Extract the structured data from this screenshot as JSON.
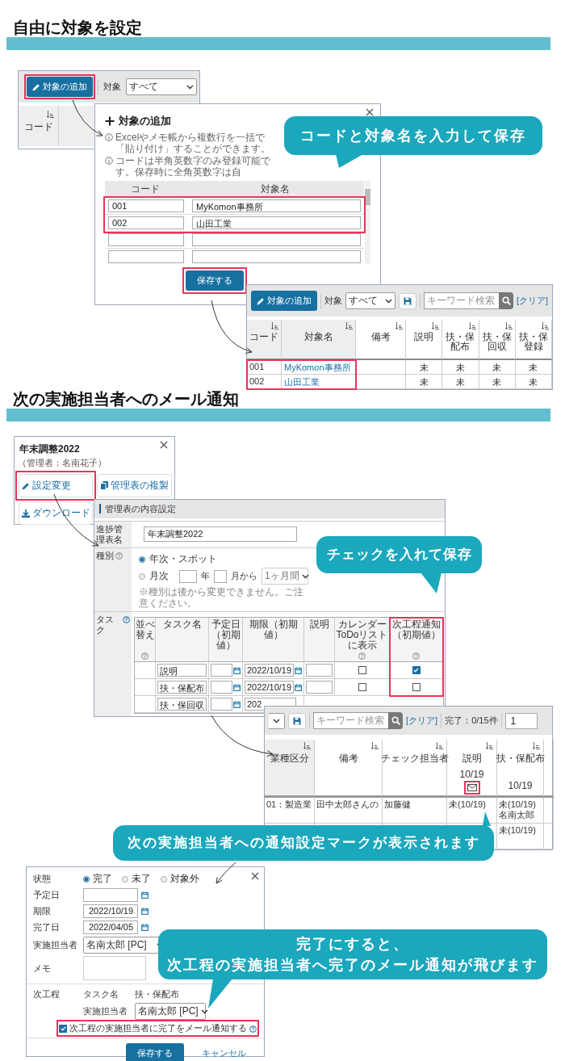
{
  "section_1": {
    "heading": "自由に対象を設定",
    "list_panel": {
      "add_button": {
        "label": "対象の追加",
        "highlighted": true
      },
      "filter_label": "対象",
      "filter_value": "すべて",
      "columns": [
        "コード"
      ]
    },
    "add_dialog": {
      "title": "対象の追加",
      "notes": [
        "Excelやメモ帳から複数行を一括で「貼り付け」することができます。",
        "コードは半角英数字のみ登録可能です。保存時に全角英数字は自"
      ],
      "columns": [
        "コード",
        "対象名"
      ],
      "rows": [
        {
          "kind": "filled",
          "code": "001",
          "name": "MyKomon事務所"
        },
        {
          "kind": "filled",
          "code": "002",
          "name": "山田工業"
        },
        {
          "kind": "blank"
        },
        {
          "kind": "blank"
        }
      ],
      "rows_highlighted": true,
      "save_button": {
        "label": "保存する",
        "highlighted": true
      }
    },
    "callout": [
      "コードと対象名を入力して保存"
    ],
    "result_panel": {
      "add_button": "対象の追加",
      "filter_label": "対象",
      "filter_value": "すべて",
      "search_placeholder": "キーワード検索",
      "clear_link": "[クリア]",
      "columns": [
        "コード",
        "対象名",
        "備考",
        "説明",
        "扶・保配布",
        "扶・保回収",
        "扶・保登録"
      ],
      "rows": [
        {
          "code": "001",
          "name": "MyKomon事務所",
          "statuses": [
            "未",
            "未",
            "未",
            "未"
          ]
        },
        {
          "code": "002",
          "name": "山田工業",
          "statuses": [
            "未",
            "未",
            "未",
            "未"
          ]
        }
      ],
      "rows_highlighted": true
    }
  },
  "section_2": {
    "heading": "次の実施担当者へのメール通知",
    "task_card": {
      "title": "年末調整2022",
      "manager": "（管理者：名南花子）",
      "buttons": [
        {
          "label": "設定変更",
          "highlighted": true
        },
        {
          "label": "管理表の複製",
          "highlighted": false
        },
        {
          "label": "ダウンロード",
          "highlighted": false
        }
      ]
    },
    "settings_panel": {
      "title": "管理表の内容設定",
      "name_label": "進捗管理表名",
      "name_value": "年末調整2022",
      "type_label": "種別",
      "type_options": [
        {
          "label": "年次・スポット",
          "selected": true
        },
        {
          "label": "月次",
          "selected": false
        }
      ],
      "year_unit": "年",
      "month_from": "月から",
      "period_value": "1ヶ月間",
      "type_note": "※種別は後から変更できません。ご注意ください。",
      "task_label": "タスク",
      "task_columns": [
        {
          "label": "並べ替え",
          "help": true
        },
        {
          "label": "タスク名",
          "help": false
        },
        {
          "label": "予定日（初期値）",
          "help": false
        },
        {
          "label": "期限（初期値）",
          "help": false
        },
        {
          "label": "説明",
          "help": false
        },
        {
          "label": "カレンダーToDoリストに表示",
          "help": true
        },
        {
          "label": "次工程通知（初期値）",
          "help": true
        }
      ],
      "tasks": [
        {
          "name": "説明",
          "due": "2022/10/19",
          "calendar": false,
          "notify": true
        },
        {
          "name": "扶・保配布",
          "due": "2022/10/19",
          "calendar": false,
          "notify": false
        },
        {
          "name": "扶・保回収",
          "due": "202"
        }
      ],
      "notify_column_highlighted": true
    },
    "callout_1": [
      "チェックを入れて保存"
    ],
    "status_panel": {
      "search_placeholder": "キーワード検索",
      "clear_link": "[クリア]",
      "progress": "完了：0/15件",
      "page": "1",
      "columns": [
        {
          "label": "業種区分",
          "mail_mark": false,
          "highlighted": false
        },
        {
          "label": "備考",
          "mail_mark": false,
          "highlighted": false
        },
        {
          "label": "チェック担当者",
          "mail_mark": false,
          "highlighted": false
        },
        {
          "label": "説明",
          "date": "10/19",
          "mail_mark": true,
          "highlighted": true
        },
        {
          "label": "扶・保配布",
          "date": "10/19",
          "mail_mark": false,
          "highlighted": false
        }
      ],
      "rows": [
        {
          "cells": [
            [
              "01：製造業"
            ],
            [
              "田中太郎さんの"
            ],
            [
              "加藤健"
            ],
            [
              "未(10/19)"
            ],
            [
              "未(10/19)",
              "名南太郎"
            ]
          ]
        },
        {
          "cells": [
            null,
            null,
            null,
            null,
            [
              "未(10/19)"
            ]
          ]
        }
      ]
    },
    "callout_2": [
      "次の実施担当者への通知設定マークが表示されます"
    ],
    "complete_dialog": {
      "status_label": "状態",
      "status_options": [
        {
          "label": "完了",
          "selected": true
        },
        {
          "label": "未了",
          "selected": false
        },
        {
          "label": "対象外",
          "selected": false
        }
      ],
      "fields": [
        {
          "label": "予定日",
          "kind": "date"
        },
        {
          "label": "期限",
          "kind": "date",
          "value": "2022/10/19"
        },
        {
          "label": "完了日",
          "kind": "date",
          "value": "2022/04/05"
        },
        {
          "label": "実施担当者",
          "kind": "select",
          "value": "名南太郎 [PC]"
        },
        {
          "label": "メモ",
          "kind": "memo"
        }
      ],
      "next_label": "次工程",
      "next_task_label": "タスク名",
      "next_task_value": "扶・保配布",
      "next_assignee_label": "実施担当者",
      "next_assignee_value": "名南太郎 [PC]",
      "notify": {
        "label": "次工程の実施担当者に完了をメール通知する",
        "checked": true,
        "highlighted": true
      },
      "save_button": "保存する",
      "cancel_button": "キャンセル"
    },
    "callout_3": [
      "完了にすると、",
      "次工程の実施担当者へ完了のメール通知が飛びます"
    ]
  }
}
